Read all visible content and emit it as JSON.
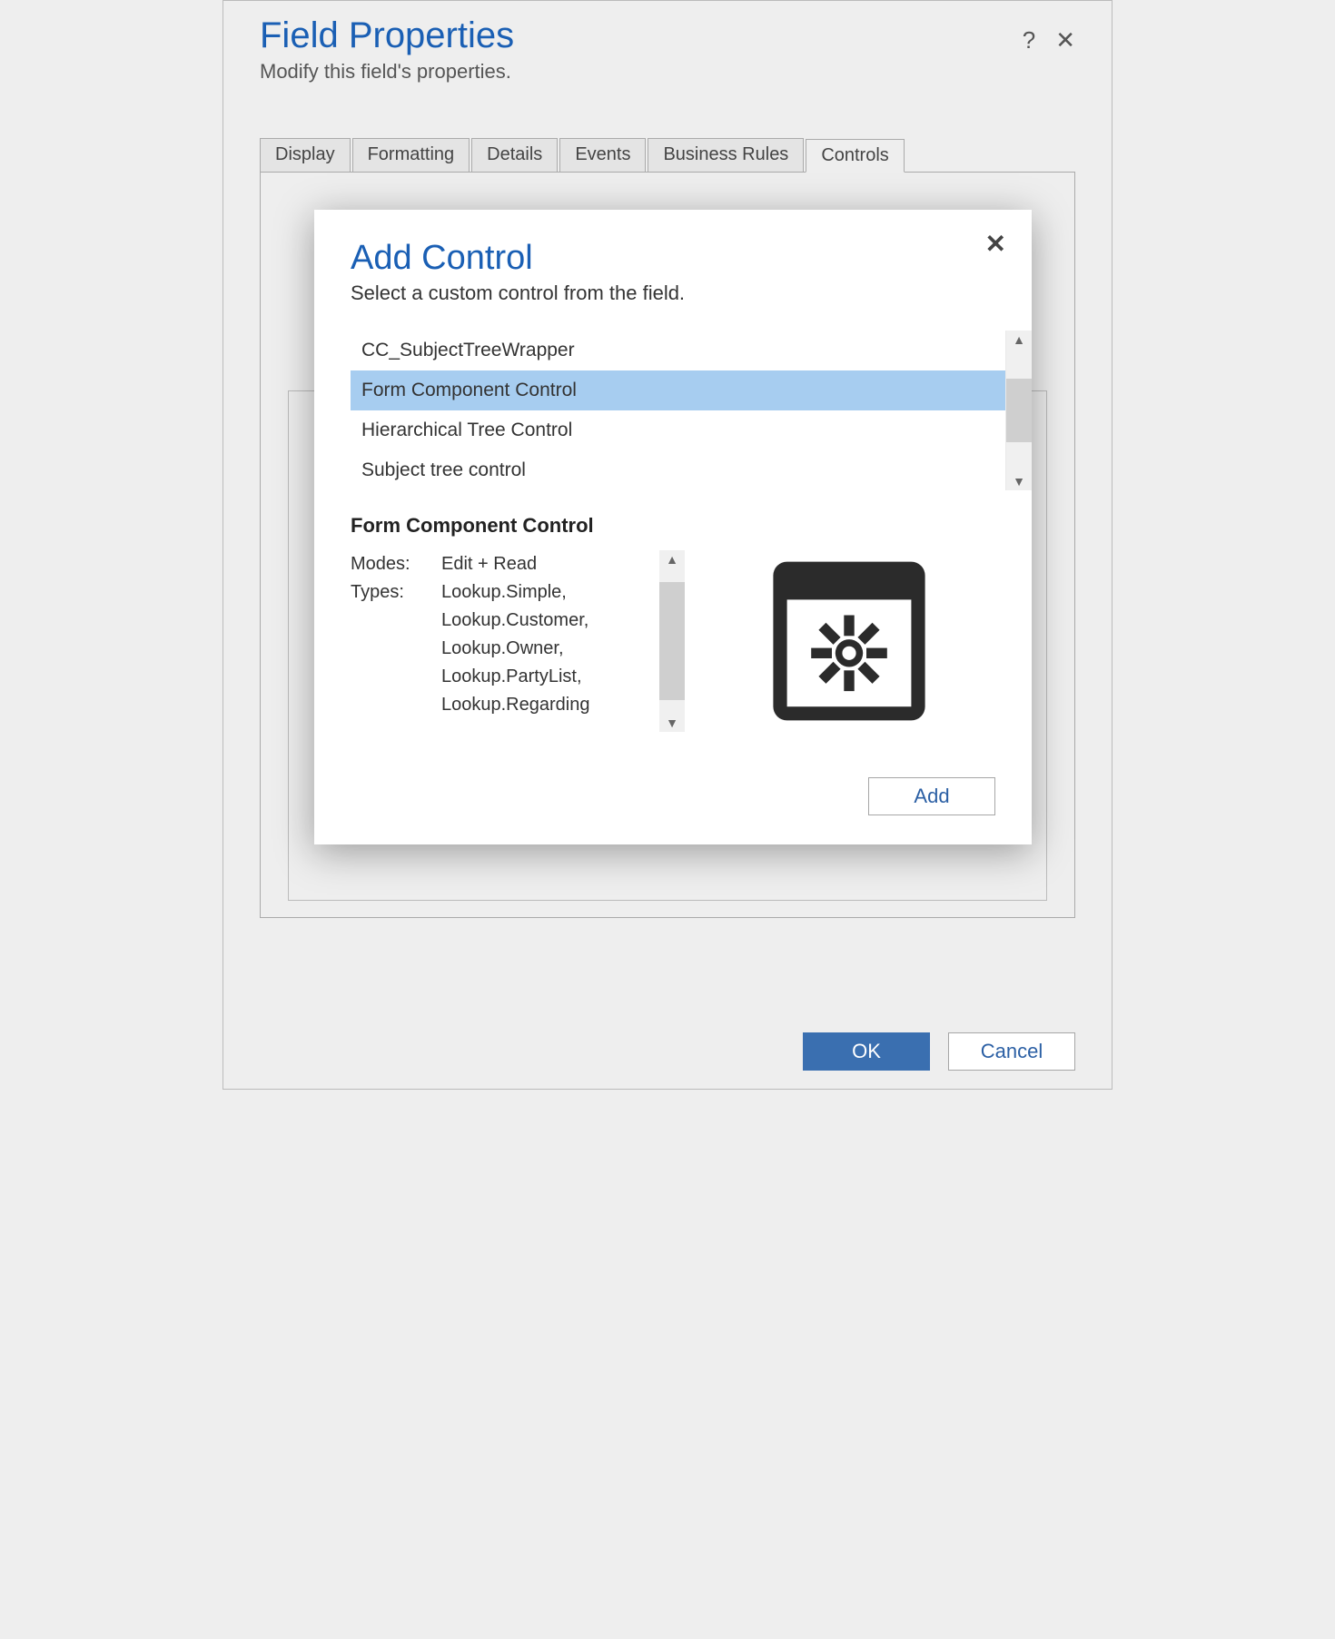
{
  "fp": {
    "title": "Field Properties",
    "subtitle": "Modify this field's properties.",
    "help_icon": "?",
    "close_icon": "✕",
    "tabs": [
      "Display",
      "Formatting",
      "Details",
      "Events",
      "Business Rules",
      "Controls"
    ],
    "active_tab_index": 5,
    "ok_label": "OK",
    "cancel_label": "Cancel"
  },
  "modal": {
    "title": "Add Control",
    "subtitle": "Select a custom control from the field.",
    "close_icon": "✕",
    "list_items": [
      "CC_SubjectTreeWrapper",
      "Form Component Control",
      "Hierarchical Tree Control",
      "Subject tree control"
    ],
    "selected_index": 1,
    "detail": {
      "heading": "Form Component Control",
      "modes_label": "Modes:",
      "modes_value": "Edit + Read",
      "types_label": "Types:",
      "types_value": "Lookup.Simple, Lookup.Customer, Lookup.Owner, Lookup.PartyList, Lookup.Regarding"
    },
    "add_label": "Add",
    "scroll_up": "▲",
    "scroll_down": "▼"
  }
}
